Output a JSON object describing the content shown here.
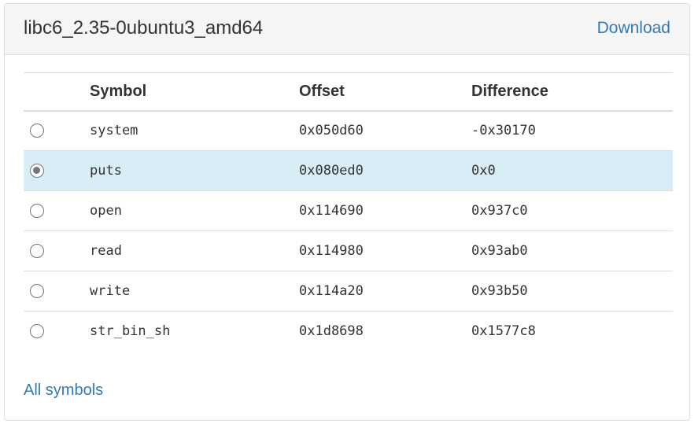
{
  "panel": {
    "title": "libc6_2.35-0ubuntu3_amd64",
    "download_label": "Download"
  },
  "table": {
    "headers": [
      "Symbol",
      "Offset",
      "Difference"
    ],
    "rows": [
      {
        "symbol": "system",
        "offset": "0x050d60",
        "difference": "-0x30170",
        "selected": false
      },
      {
        "symbol": "puts",
        "offset": "0x080ed0",
        "difference": "0x0",
        "selected": true
      },
      {
        "symbol": "open",
        "offset": "0x114690",
        "difference": "0x937c0",
        "selected": false
      },
      {
        "symbol": "read",
        "offset": "0x114980",
        "difference": "0x93ab0",
        "selected": false
      },
      {
        "symbol": "write",
        "offset": "0x114a20",
        "difference": "0x93b50",
        "selected": false
      },
      {
        "symbol": "str_bin_sh",
        "offset": "0x1d8698",
        "difference": "0x1577c8",
        "selected": false
      }
    ]
  },
  "footer": {
    "all_symbols_label": "All symbols"
  },
  "colors": {
    "link": "#337ab7",
    "selected_row": "#d9edf7",
    "heading_bg": "#f5f5f5",
    "border": "#dddddd"
  }
}
